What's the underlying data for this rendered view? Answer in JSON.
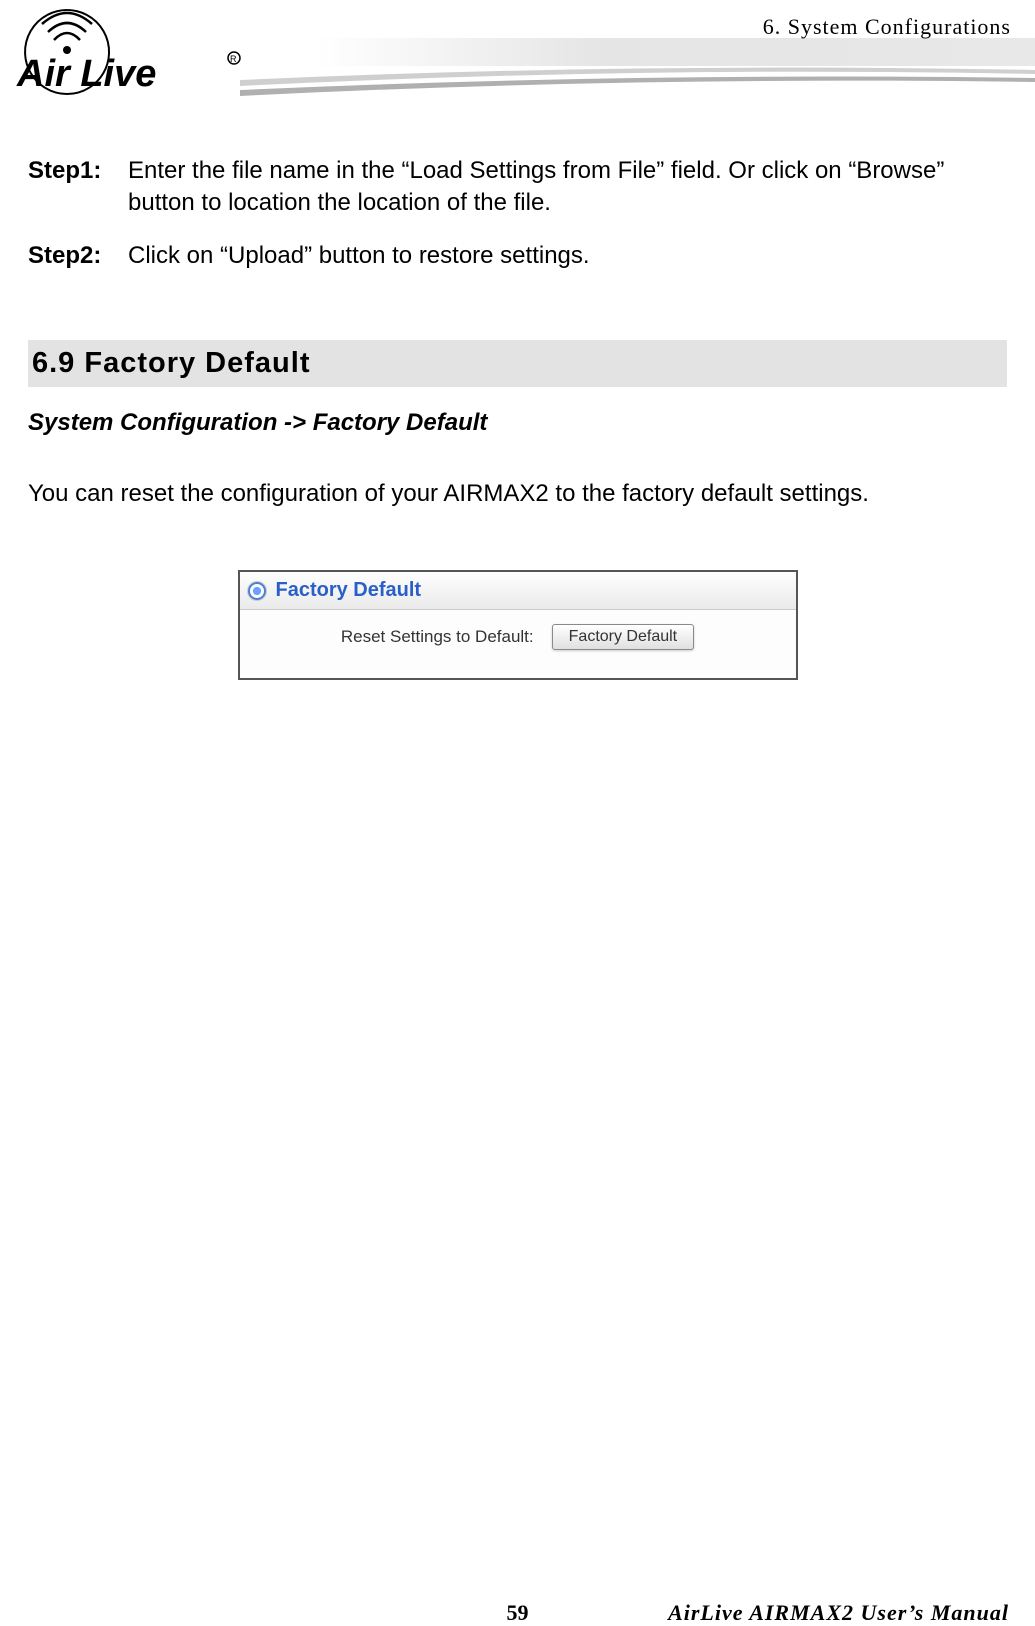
{
  "header": {
    "chapter_label": "6.  System Configurations"
  },
  "steps": [
    {
      "label": "Step1",
      "text": "Enter the file name in the “Load Settings from File” field.   Or click on “Browse” button to location the location of the file."
    },
    {
      "label": "Step2",
      "text": "Click on “Upload” button to restore settings."
    }
  ],
  "section": {
    "heading": "6.9 Factory  Default",
    "breadcrumb": "System Configuration -> Factory Default",
    "description": "You can reset the configuration of your AIRMAX2 to the factory default settings."
  },
  "panel": {
    "title": "Factory Default",
    "label": "Reset Settings to Default:",
    "button_label": "Factory Default"
  },
  "footer": {
    "page_number": "59",
    "manual_title": "AirLive AIRMAX2 User’s Manual"
  }
}
